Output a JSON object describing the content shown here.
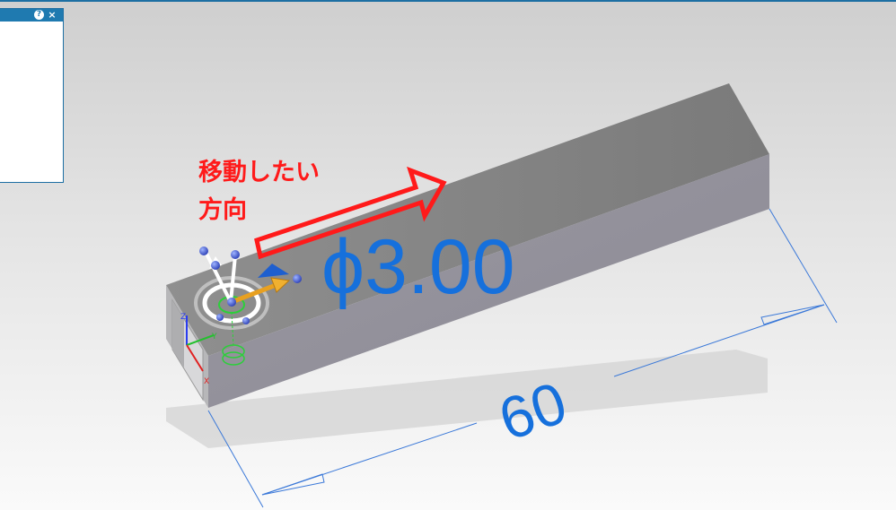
{
  "panel": {
    "help_icon": "?",
    "close_icon": "×"
  },
  "annotation": {
    "line1": "移動したい",
    "line2": "方向"
  },
  "dimensions": {
    "diameter": "ϕ3.00",
    "length": "60"
  },
  "triad": {
    "axis_z": "Z",
    "axis_y": "Y",
    "axis_x": "X"
  },
  "colors": {
    "annotation_red": "#ff1a1a",
    "dimension_blue": "#1670dc",
    "accent_blue": "#1f7ab0"
  }
}
